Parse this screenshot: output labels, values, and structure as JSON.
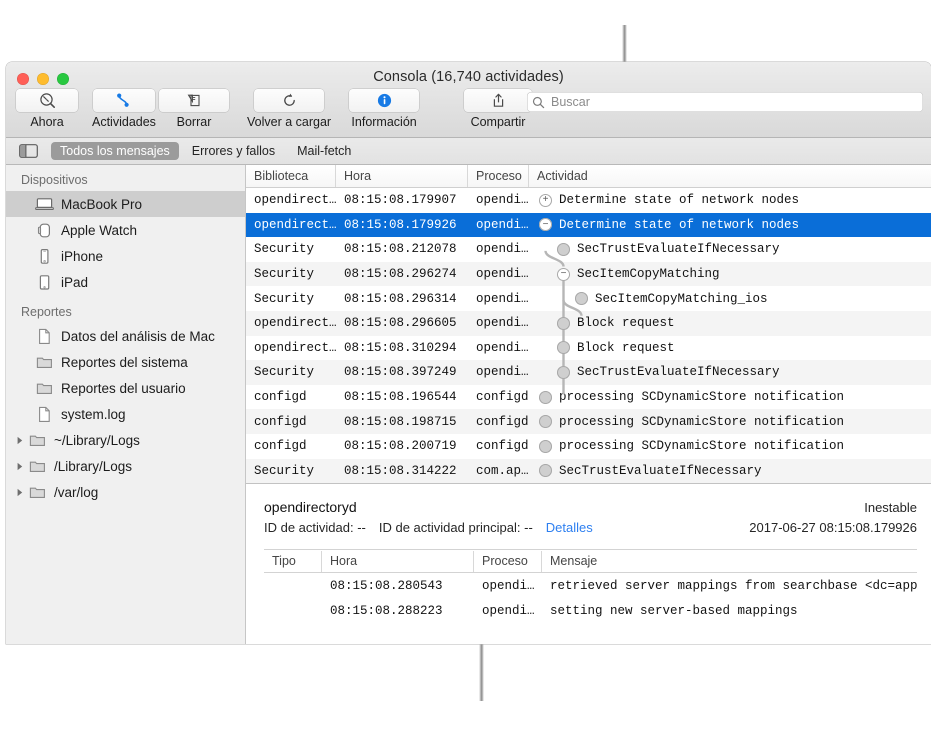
{
  "window": {
    "title": "Consola (16,740 actividades)",
    "traffic_lights": [
      "close",
      "minimize",
      "zoom"
    ]
  },
  "toolbar": {
    "buttons": [
      {
        "label": "Ahora",
        "icon": "now-magnifier-icon"
      },
      {
        "label": "Actividades",
        "icon": "activities-nodes-icon"
      },
      {
        "label": "Borrar",
        "icon": "clear-icon"
      },
      {
        "label": "Volver a cargar",
        "icon": "reload-icon"
      },
      {
        "label": "Información",
        "icon": "info-icon"
      },
      {
        "label": "Compartir",
        "icon": "share-icon"
      }
    ],
    "search": {
      "placeholder": "Buscar",
      "value": "",
      "icon": "search-icon"
    }
  },
  "filterbar": {
    "sidebar_toggle_icon": "sidebar-toggle-icon",
    "tabs": [
      {
        "label": "Todos los mensajes",
        "active": true
      },
      {
        "label": "Errores y fallos",
        "active": false
      },
      {
        "label": "Mail-fetch",
        "active": false
      }
    ]
  },
  "sidebar": {
    "sections": [
      {
        "header": "Dispositivos",
        "items": [
          {
            "label": "MacBook Pro",
            "icon": "laptop-icon",
            "selected": true,
            "disclosure": false
          },
          {
            "label": "Apple Watch",
            "icon": "watch-icon",
            "selected": false,
            "disclosure": false
          },
          {
            "label": "iPhone",
            "icon": "iphone-icon",
            "selected": false,
            "disclosure": false
          },
          {
            "label": "iPad",
            "icon": "ipad-icon",
            "selected": false,
            "disclosure": false
          }
        ]
      },
      {
        "header": "Reportes",
        "items": [
          {
            "label": "Datos del análisis de Mac",
            "icon": "document-icon",
            "selected": false,
            "disclosure": false
          },
          {
            "label": "Reportes del sistema",
            "icon": "folder-icon",
            "selected": false,
            "disclosure": false
          },
          {
            "label": "Reportes del usuario",
            "icon": "folder-icon",
            "selected": false,
            "disclosure": false
          },
          {
            "label": "system.log",
            "icon": "document-icon",
            "selected": false,
            "disclosure": false
          },
          {
            "label": "~/Library/Logs",
            "icon": "folder-icon",
            "selected": false,
            "disclosure": true
          },
          {
            "label": "/Library/Logs",
            "icon": "folder-icon",
            "selected": false,
            "disclosure": true
          },
          {
            "label": "/var/log",
            "icon": "folder-icon",
            "selected": false,
            "disclosure": true
          }
        ]
      }
    ]
  },
  "log_table": {
    "columns": [
      "Biblioteca",
      "Hora",
      "Proceso",
      "Actividad"
    ],
    "rows": [
      {
        "biblioteca": "opendirect…",
        "hora": "08:15:08.179907",
        "proceso": "opendi…",
        "actividad": "Determine state of network nodes",
        "indent": 0,
        "node": "plus",
        "selected": false
      },
      {
        "biblioteca": "opendirect…",
        "hora": "08:15:08.179926",
        "proceso": "opendi…",
        "actividad": "Determine state of network nodes",
        "indent": 0,
        "node": "minus",
        "selected": true
      },
      {
        "biblioteca": "Security",
        "hora": "08:15:08.212078",
        "proceso": "opendi…",
        "actividad": "SecTrustEvaluateIfNecessary",
        "indent": 1,
        "node": "open",
        "selected": false
      },
      {
        "biblioteca": "Security",
        "hora": "08:15:08.296274",
        "proceso": "opendi…",
        "actividad": "SecItemCopyMatching",
        "indent": 1,
        "node": "minus",
        "selected": false
      },
      {
        "biblioteca": "Security",
        "hora": "08:15:08.296314",
        "proceso": "opendi…",
        "actividad": "SecItemCopyMatching_ios",
        "indent": 2,
        "node": "open",
        "selected": false
      },
      {
        "biblioteca": "opendirect…",
        "hora": "08:15:08.296605",
        "proceso": "opendi…",
        "actividad": "Block request",
        "indent": 1,
        "node": "open",
        "selected": false
      },
      {
        "biblioteca": "opendirect…",
        "hora": "08:15:08.310294",
        "proceso": "opendi…",
        "actividad": "Block request",
        "indent": 1,
        "node": "open",
        "selected": false
      },
      {
        "biblioteca": "Security",
        "hora": "08:15:08.397249",
        "proceso": "opendi…",
        "actividad": "SecTrustEvaluateIfNecessary",
        "indent": 1,
        "node": "open",
        "selected": false
      },
      {
        "biblioteca": "configd",
        "hora": "08:15:08.196544",
        "proceso": "configd",
        "actividad": "processing SCDynamicStore notification",
        "indent": 0,
        "node": "open",
        "selected": false
      },
      {
        "biblioteca": "configd",
        "hora": "08:15:08.198715",
        "proceso": "configd",
        "actividad": "processing SCDynamicStore notification",
        "indent": 0,
        "node": "open",
        "selected": false
      },
      {
        "biblioteca": "configd",
        "hora": "08:15:08.200719",
        "proceso": "configd",
        "actividad": "processing SCDynamicStore notification",
        "indent": 0,
        "node": "open",
        "selected": false
      },
      {
        "biblioteca": "Security",
        "hora": "08:15:08.314222",
        "proceso": "com.ap…",
        "actividad": "SecTrustEvaluateIfNecessary",
        "indent": 0,
        "node": "open",
        "selected": false
      }
    ]
  },
  "detail": {
    "process": "opendirectoryd",
    "state": "Inestable",
    "activity_id_label": "ID de actividad: --",
    "parent_activity_id_label": "ID de actividad principal: --",
    "details_link": "Detalles",
    "timestamp": "2017-06-27 08:15:08.179926",
    "columns": [
      "Tipo",
      "Hora",
      "Proceso",
      "Mensaje"
    ],
    "rows": [
      {
        "tipo": "",
        "hora": "08:15:08.280543",
        "proceso": "opendi…",
        "mensaje": "retrieved server mappings from searchbase <dc=apple…"
      },
      {
        "tipo": "",
        "hora": "08:15:08.288223",
        "proceso": "opendi…",
        "mensaje": "setting new server-based mappings"
      }
    ]
  },
  "colors": {
    "selection_blue": "#0a6ed8",
    "link_blue": "#2d7ff0",
    "accent_icon_blue": "#177ae5",
    "sidebar_bg": "#f0f0f0",
    "row_alt": "#f4f4f4"
  }
}
